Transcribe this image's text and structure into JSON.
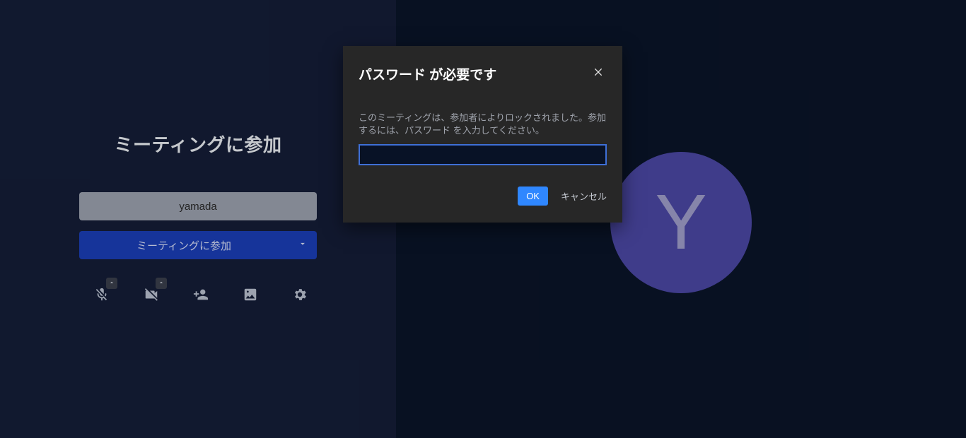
{
  "prejoin": {
    "title": "ミーティングに参加",
    "name_value": "yamada",
    "join_label": "ミーティングに参加"
  },
  "toolbar": {
    "mic": {
      "name": "mic-muted-icon"
    },
    "camera": {
      "name": "camera-off-icon"
    },
    "invite": {
      "name": "add-user-icon"
    },
    "background": {
      "name": "image-icon"
    },
    "settings": {
      "name": "gear-icon"
    }
  },
  "avatar": {
    "letter": "Y",
    "color": "#4b47a3"
  },
  "dialog": {
    "title": "パスワード が必要です",
    "message": "このミーティングは、参加者によりロックされました。参加するには、パスワード を入力してください。",
    "input_value": "",
    "ok_label": "OK",
    "cancel_label": "キャンセル"
  }
}
